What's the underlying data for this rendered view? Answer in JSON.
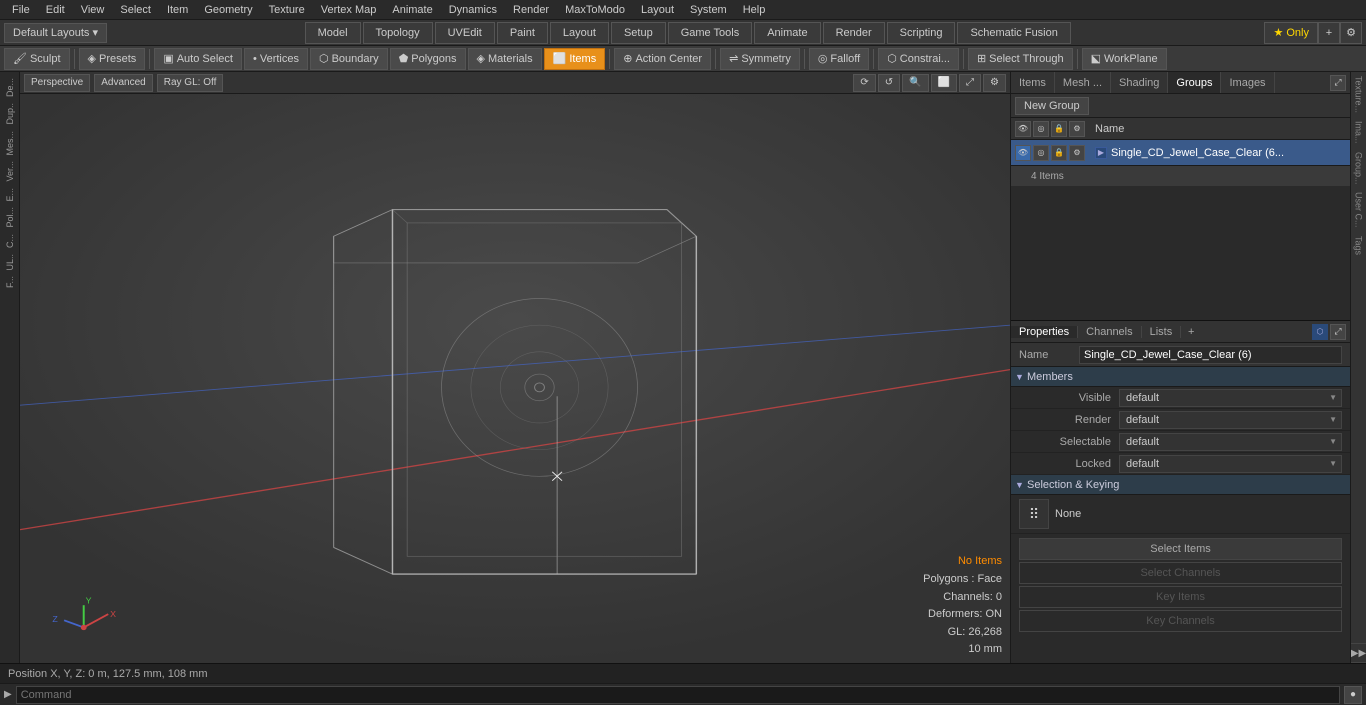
{
  "menuBar": {
    "items": [
      "File",
      "Edit",
      "View",
      "Select",
      "Item",
      "Geometry",
      "Texture",
      "Vertex Map",
      "Animate",
      "Dynamics",
      "Render",
      "MaxToModo",
      "Layout",
      "System",
      "Help"
    ]
  },
  "layoutBar": {
    "selector": "Default Layouts ▾",
    "tabs": [
      {
        "label": "Model",
        "active": false
      },
      {
        "label": "Topology",
        "active": false
      },
      {
        "label": "UVEdit",
        "active": false
      },
      {
        "label": "Paint",
        "active": false
      },
      {
        "label": "Layout",
        "active": false
      },
      {
        "label": "Setup",
        "active": false
      },
      {
        "label": "Game Tools",
        "active": false
      },
      {
        "label": "Animate",
        "active": false
      },
      {
        "label": "Render",
        "active": false
      },
      {
        "label": "Scripting",
        "active": false
      },
      {
        "label": "Schematic Fusion",
        "active": false
      }
    ],
    "onlyLabel": "★ Only",
    "addLabel": "+"
  },
  "toolbar": {
    "items": [
      {
        "label": "Sculpt",
        "active": false,
        "icon": "sculpt"
      },
      {
        "label": "Presets",
        "active": false,
        "icon": "preset"
      },
      {
        "label": "Auto Select",
        "active": false,
        "icon": "auto-select"
      },
      {
        "label": "Vertices",
        "active": false,
        "icon": "vertices"
      },
      {
        "label": "Boundary",
        "active": false,
        "icon": "boundary"
      },
      {
        "label": "Polygons",
        "active": false,
        "icon": "polygons"
      },
      {
        "label": "Materials",
        "active": false,
        "icon": "materials"
      },
      {
        "label": "Items",
        "active": true,
        "icon": "items"
      },
      {
        "label": "Action Center",
        "active": false,
        "icon": "action-center"
      },
      {
        "label": "Symmetry",
        "active": false,
        "icon": "symmetry"
      },
      {
        "label": "Falloff",
        "active": false,
        "icon": "falloff"
      },
      {
        "label": "Constrai...",
        "active": false,
        "icon": "constraint"
      },
      {
        "label": "Select Through",
        "active": false,
        "icon": "select-through"
      },
      {
        "label": "WorkPlane",
        "active": false,
        "icon": "workplane"
      }
    ]
  },
  "viewport": {
    "type": "Perspective",
    "renderMode": "Advanced",
    "glMode": "Ray GL: Off",
    "info": {
      "noItems": "No Items",
      "polygons": "Polygons : Face",
      "channels": "Channels: 0",
      "deformers": "Deformers: ON",
      "gl": "GL: 26,268",
      "size": "10 mm"
    }
  },
  "rightPanel": {
    "mainTabs": [
      "Items",
      "Mesh ...",
      "Shading",
      "Groups",
      "Images"
    ],
    "activeTab": "Groups",
    "newGroupBtn": "New Group",
    "subTabs": [
      "Items",
      "Mesh ...",
      "Shading",
      "Groups",
      "Images"
    ],
    "groupsSubTabs": [
      "Properties",
      "Channels",
      "Lists"
    ],
    "activeSubTab": "Properties",
    "groupName": "Single_CD_Jewel_Case_Clear",
    "columnHeaders": [
      "Name"
    ],
    "groups": [
      {
        "name": "Single_CD_Jewel_Case_Clear (6...",
        "sub": "4 Items",
        "expanded": true
      }
    ]
  },
  "properties": {
    "propTabs": [
      "Properties",
      "Channels",
      "Lists"
    ],
    "activeTab": "Properties",
    "nameField": "Single_CD_Jewel_Case_Clear (6)",
    "sections": {
      "members": {
        "title": "Members",
        "fields": [
          {
            "label": "Visible",
            "value": "default"
          },
          {
            "label": "Render",
            "value": "default"
          },
          {
            "label": "Selectable",
            "value": "default"
          },
          {
            "label": "Locked",
            "value": "default"
          }
        ]
      },
      "selectionKeying": {
        "title": "Selection & Keying",
        "noneLabel": "None",
        "buttons": [
          {
            "label": "Select Items",
            "disabled": false
          },
          {
            "label": "Select Channels",
            "disabled": true
          },
          {
            "label": "Key Items",
            "disabled": true
          },
          {
            "label": "Key Channels",
            "disabled": true
          }
        ]
      }
    }
  },
  "rightStrip": {
    "items": [
      "Texture...",
      "Ima...",
      "Group...",
      "User C...",
      "Tags"
    ]
  },
  "bottomBar": {
    "arrow": "▶",
    "placeholder": "Command",
    "executeIcon": "●"
  },
  "statusBar": {
    "text": "Position X, Y, Z:  0 m, 127.5 mm, 108 mm"
  }
}
